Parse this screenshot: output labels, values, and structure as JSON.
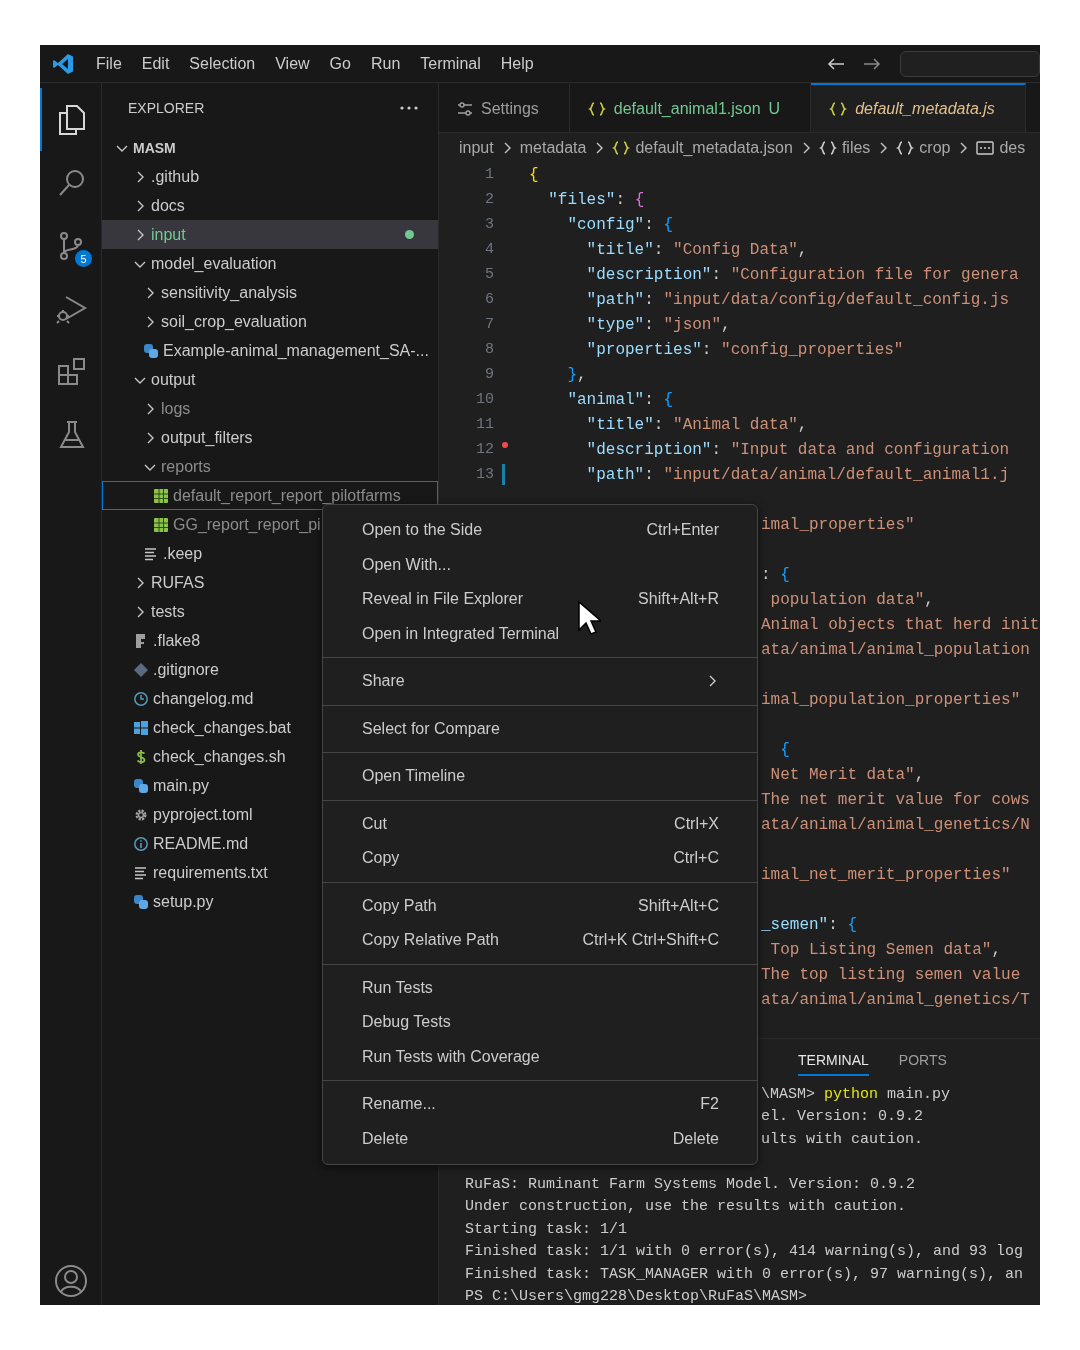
{
  "title_bar": {
    "menu": [
      "File",
      "Edit",
      "Selection",
      "View",
      "Go",
      "Run",
      "Terminal",
      "Help"
    ]
  },
  "activity_bar": {
    "items": [
      {
        "kind": "explorer",
        "selected": true
      },
      {
        "kind": "search",
        "selected": false
      },
      {
        "kind": "source_control",
        "selected": false,
        "badge": "5"
      },
      {
        "kind": "run_debug",
        "selected": false
      },
      {
        "kind": "extensions",
        "selected": false
      },
      {
        "kind": "testing",
        "selected": false
      }
    ]
  },
  "sidebar": {
    "title": "EXPLORER",
    "root": {
      "label": "MASM",
      "expanded": true,
      "children": [
        {
          "label": ".github",
          "kind": "folder",
          "expanded": false,
          "selected": false,
          "focused": false,
          "modified": false,
          "ignored": false
        },
        {
          "label": "docs",
          "kind": "folder",
          "expanded": false,
          "selected": false,
          "focused": false,
          "modified": false,
          "ignored": false
        },
        {
          "label": "input",
          "kind": "folder",
          "expanded": false,
          "selected": true,
          "focused": false,
          "modified": true,
          "ignored": false
        },
        {
          "label": "model_evaluation",
          "kind": "folder",
          "expanded": true,
          "selected": false,
          "focused": false,
          "modified": false,
          "ignored": false,
          "children": [
            {
              "label": "sensitivity_analysis",
              "kind": "folder",
              "expanded": false,
              "selected": false,
              "focused": false,
              "modified": false,
              "ignored": false
            },
            {
              "label": "soil_crop_evaluation",
              "kind": "folder",
              "expanded": false,
              "selected": false,
              "focused": false,
              "modified": false,
              "ignored": false
            },
            {
              "label": "Example-animal_management_SA-...",
              "kind": "python",
              "selected": false,
              "focused": false,
              "modified": false,
              "ignored": false
            }
          ]
        },
        {
          "label": "output",
          "kind": "folder",
          "expanded": true,
          "selected": false,
          "focused": false,
          "modified": false,
          "ignored": false,
          "children": [
            {
              "label": "logs",
              "kind": "folder",
              "expanded": false,
              "selected": false,
              "focused": false,
              "modified": false,
              "ignored": true
            },
            {
              "label": "output_filters",
              "kind": "folder",
              "expanded": false,
              "selected": false,
              "focused": false,
              "modified": false,
              "ignored": false
            },
            {
              "label": "reports",
              "kind": "folder",
              "expanded": true,
              "selected": false,
              "focused": false,
              "modified": false,
              "ignored": true,
              "children": [
                {
                  "label": "default_report_report_pilotfarms",
                  "kind": "table",
                  "selected": false,
                  "focused": true,
                  "modified": false,
                  "ignored": true
                },
                {
                  "label": "GG_report_report_pi",
                  "kind": "table",
                  "selected": false,
                  "focused": false,
                  "modified": false,
                  "ignored": true
                }
              ]
            },
            {
              "label": ".keep",
              "kind": "lines",
              "selected": false,
              "focused": false,
              "modified": false,
              "ignored": false
            }
          ]
        },
        {
          "label": "RUFAS",
          "kind": "folder",
          "expanded": false,
          "selected": false,
          "focused": false,
          "modified": false,
          "ignored": false
        },
        {
          "label": "tests",
          "kind": "folder",
          "expanded": false,
          "selected": false,
          "focused": false,
          "modified": false,
          "ignored": false
        },
        {
          "label": ".flake8",
          "kind": "flake",
          "selected": false,
          "focused": false,
          "modified": false,
          "ignored": false
        },
        {
          "label": ".gitignore",
          "kind": "git",
          "selected": false,
          "focused": false,
          "modified": false,
          "ignored": false
        },
        {
          "label": "changelog.md",
          "kind": "clock",
          "selected": false,
          "focused": false,
          "modified": false,
          "ignored": false
        },
        {
          "label": "check_changes.bat",
          "kind": "windows",
          "selected": false,
          "focused": false,
          "modified": false,
          "ignored": false
        },
        {
          "label": "check_changes.sh",
          "kind": "dollar",
          "selected": false,
          "focused": false,
          "modified": false,
          "ignored": false
        },
        {
          "label": "main.py",
          "kind": "python",
          "selected": false,
          "focused": false,
          "modified": false,
          "ignored": false
        },
        {
          "label": "pyproject.toml",
          "kind": "gear",
          "selected": false,
          "focused": false,
          "modified": false,
          "ignored": false
        },
        {
          "label": "README.md",
          "kind": "info",
          "selected": false,
          "focused": false,
          "modified": false,
          "ignored": false
        },
        {
          "label": "requirements.txt",
          "kind": "lines",
          "selected": false,
          "focused": false,
          "modified": false,
          "ignored": false
        },
        {
          "label": "setup.py",
          "kind": "python",
          "selected": false,
          "focused": false,
          "modified": false,
          "ignored": false
        }
      ]
    }
  },
  "editor": {
    "tabs": [
      {
        "label": "Settings",
        "kind": "settings",
        "selected": false,
        "preview": false,
        "untracked": false
      },
      {
        "label": "default_animal1.json",
        "kind": "json",
        "selected": false,
        "preview": false,
        "untracked": true,
        "decoration": "U"
      },
      {
        "label": "default_metadata.js",
        "kind": "json",
        "selected": true,
        "preview": true,
        "untracked": false
      }
    ],
    "breadcrumbs": [
      {
        "label": "input",
        "kind": "folder"
      },
      {
        "label": "metadata",
        "kind": "folder"
      },
      {
        "label": "default_metadata.json",
        "kind": "json"
      },
      {
        "label": "files",
        "kind": "object"
      },
      {
        "label": "crop",
        "kind": "object"
      },
      {
        "label": "des",
        "kind": "field"
      }
    ],
    "lines": [
      {
        "kind": "code",
        "number": "1",
        "tokens": [
          {
            "kind": "brace1",
            "text": "{"
          }
        ]
      },
      {
        "kind": "code",
        "number": "2",
        "tokens": [
          {
            "kind": "key",
            "text": "  \"files\""
          },
          {
            "kind": "punct",
            "text": ": "
          },
          {
            "kind": "brace2",
            "text": "{"
          }
        ]
      },
      {
        "kind": "code",
        "number": "3",
        "tokens": [
          {
            "kind": "key",
            "text": "    \"config\""
          },
          {
            "kind": "punct",
            "text": ": "
          },
          {
            "kind": "brace3",
            "text": "{"
          }
        ]
      },
      {
        "kind": "code",
        "number": "4",
        "tokens": [
          {
            "kind": "key",
            "text": "      \"title\""
          },
          {
            "kind": "punct",
            "text": ": "
          },
          {
            "kind": "string",
            "text": "\"Config Data\""
          },
          {
            "kind": "punct",
            "text": ","
          }
        ]
      },
      {
        "kind": "code",
        "number": "5",
        "tokens": [
          {
            "kind": "key",
            "text": "      \"description\""
          },
          {
            "kind": "punct",
            "text": ": "
          },
          {
            "kind": "string",
            "text": "\"Configuration file for genera"
          }
        ]
      },
      {
        "kind": "code",
        "number": "6",
        "tokens": [
          {
            "kind": "key",
            "text": "      \"path\""
          },
          {
            "kind": "punct",
            "text": ": "
          },
          {
            "kind": "string",
            "text": "\"input/data/config/default_config.js"
          }
        ]
      },
      {
        "kind": "code",
        "number": "7",
        "tokens": [
          {
            "kind": "key",
            "text": "      \"type\""
          },
          {
            "kind": "punct",
            "text": ": "
          },
          {
            "kind": "string",
            "text": "\"json\""
          },
          {
            "kind": "punct",
            "text": ","
          }
        ]
      },
      {
        "kind": "code",
        "number": "8",
        "tokens": [
          {
            "kind": "key",
            "text": "      \"properties\""
          },
          {
            "kind": "punct",
            "text": ": "
          },
          {
            "kind": "string",
            "text": "\"config_properties\""
          }
        ]
      },
      {
        "kind": "code",
        "number": "9",
        "tokens": [
          {
            "kind": "brace3",
            "text": "    }"
          },
          {
            "kind": "punct",
            "text": ","
          }
        ]
      },
      {
        "kind": "code",
        "number": "10",
        "tokens": [
          {
            "kind": "key",
            "text": "    \"animal\""
          },
          {
            "kind": "punct",
            "text": ": "
          },
          {
            "kind": "brace3",
            "text": "{"
          }
        ]
      },
      {
        "kind": "code",
        "number": "11",
        "tokens": [
          {
            "kind": "key",
            "text": "      \"title\""
          },
          {
            "kind": "punct",
            "text": ": "
          },
          {
            "kind": "string",
            "text": "\"Animal data\""
          },
          {
            "kind": "punct",
            "text": ","
          }
        ]
      },
      {
        "kind": "code_deleted",
        "number": "12",
        "tokens": [
          {
            "kind": "key",
            "text": "      \"description\""
          },
          {
            "kind": "punct",
            "text": ": "
          },
          {
            "kind": "string",
            "text": "\"Input data and configuration"
          }
        ]
      },
      {
        "kind": "code_modified",
        "number": "13",
        "tokens": [
          {
            "kind": "key",
            "text": "      \"path\""
          },
          {
            "kind": "punct",
            "text": ": "
          },
          {
            "kind": "string",
            "text": "\"input/data/animal/default_animal1.j"
          }
        ]
      },
      {
        "kind": "hidden"
      },
      {
        "kind": "fragment",
        "tokens": [
          {
            "kind": "string",
            "text": "imal_properties\""
          }
        ]
      },
      {
        "kind": "hidden"
      },
      {
        "kind": "fragment",
        "tokens": [
          {
            "kind": "punct",
            "text": ": "
          },
          {
            "kind": "brace3",
            "text": "{"
          }
        ]
      },
      {
        "kind": "fragment",
        "tokens": [
          {
            "kind": "string",
            "text": " population data\""
          },
          {
            "kind": "punct",
            "text": ","
          }
        ]
      },
      {
        "kind": "fragment",
        "tokens": [
          {
            "kind": "string",
            "text": "Animal objects that herd init"
          }
        ]
      },
      {
        "kind": "fragment",
        "tokens": [
          {
            "kind": "string",
            "text": "ata/animal/animal_population"
          }
        ]
      },
      {
        "kind": "hidden"
      },
      {
        "kind": "fragment",
        "tokens": [
          {
            "kind": "string",
            "text": "imal_population_properties\""
          }
        ]
      },
      {
        "kind": "hidden"
      },
      {
        "kind": "fragment",
        "tokens": [
          {
            "kind": "brace3",
            "text": "  {"
          }
        ]
      },
      {
        "kind": "fragment",
        "tokens": [
          {
            "kind": "string",
            "text": " Net Merit data\""
          },
          {
            "kind": "punct",
            "text": ","
          }
        ]
      },
      {
        "kind": "fragment",
        "tokens": [
          {
            "kind": "string",
            "text": "The net merit value for cows"
          }
        ]
      },
      {
        "kind": "fragment",
        "tokens": [
          {
            "kind": "string",
            "text": "ata/animal/animal_genetics/N"
          }
        ]
      },
      {
        "kind": "hidden"
      },
      {
        "kind": "fragment",
        "tokens": [
          {
            "kind": "string",
            "text": "imal_net_merit_properties\""
          }
        ]
      },
      {
        "kind": "hidden"
      },
      {
        "kind": "fragment",
        "tokens": [
          {
            "kind": "key",
            "text": "_semen\""
          },
          {
            "kind": "punct",
            "text": ": "
          },
          {
            "kind": "brace3",
            "text": "{"
          }
        ]
      },
      {
        "kind": "fragment",
        "tokens": [
          {
            "kind": "string",
            "text": " Top Listing Semen data\""
          },
          {
            "kind": "punct",
            "text": ","
          }
        ]
      },
      {
        "kind": "fragment",
        "tokens": [
          {
            "kind": "string",
            "text": "The top listing semen value"
          }
        ]
      },
      {
        "kind": "fragment",
        "tokens": [
          {
            "kind": "string",
            "text": "ata/animal/animal_genetics/T"
          }
        ]
      }
    ]
  },
  "panel": {
    "tabs": [
      {
        "label": "TERMINAL",
        "selected": true
      },
      {
        "label": "PORTS",
        "selected": false
      }
    ],
    "lines": [
      {
        "kind": "fragment",
        "tokens": [
          {
            "kind": "plain",
            "text": "\\MASM> "
          },
          {
            "kind": "command",
            "text": "python"
          },
          {
            "kind": "plain",
            "text": " main.py"
          }
        ]
      },
      {
        "kind": "fragment",
        "tokens": [
          {
            "kind": "plain",
            "text": "el. Version: 0.9.2"
          }
        ]
      },
      {
        "kind": "fragment",
        "tokens": [
          {
            "kind": "plain",
            "text": "ults with caution."
          }
        ]
      },
      {
        "kind": "hidden"
      },
      {
        "kind": "full",
        "tokens": [
          {
            "kind": "plain",
            "text": "RuFaS: Ruminant Farm Systems Model. Version: 0.9.2"
          }
        ]
      },
      {
        "kind": "full",
        "tokens": [
          {
            "kind": "plain",
            "text": "Under construction, use the results with caution."
          }
        ]
      },
      {
        "kind": "full",
        "tokens": [
          {
            "kind": "plain",
            "text": "Starting task: 1/1"
          }
        ]
      },
      {
        "kind": "full",
        "tokens": [
          {
            "kind": "plain",
            "text": "Finished task: 1/1 with 0 error(s), 414 warning(s), and 93 log"
          }
        ]
      },
      {
        "kind": "full",
        "tokens": [
          {
            "kind": "plain",
            "text": "Finished task: TASK_MANAGER with 0 error(s), 97 warning(s), an"
          }
        ]
      },
      {
        "kind": "full",
        "tokens": [
          {
            "kind": "plain",
            "text": "PS C:\\Users\\gmg228\\Desktop\\RuFaS\\MASM>"
          }
        ]
      }
    ]
  },
  "context_menu": {
    "groups": [
      {
        "items": [
          {
            "label": "Open to the Side",
            "shortcut": "Ctrl+Enter",
            "submenu": false
          },
          {
            "label": "Open With...",
            "submenu": false
          },
          {
            "label": "Reveal in File Explorer",
            "shortcut": "Shift+Alt+R",
            "submenu": false
          },
          {
            "label": "Open in Integrated Terminal",
            "submenu": false
          }
        ]
      },
      {
        "items": [
          {
            "label": "Share",
            "submenu": true
          }
        ]
      },
      {
        "items": [
          {
            "label": "Select for Compare",
            "submenu": false
          }
        ]
      },
      {
        "items": [
          {
            "label": "Open Timeline",
            "submenu": false
          }
        ]
      },
      {
        "items": [
          {
            "label": "Cut",
            "shortcut": "Ctrl+X",
            "submenu": false
          },
          {
            "label": "Copy",
            "shortcut": "Ctrl+C",
            "submenu": false
          }
        ]
      },
      {
        "items": [
          {
            "label": "Copy Path",
            "shortcut": "Shift+Alt+C",
            "submenu": false
          },
          {
            "label": "Copy Relative Path",
            "shortcut": "Ctrl+K Ctrl+Shift+C",
            "submenu": false
          }
        ]
      },
      {
        "items": [
          {
            "label": "Run Tests",
            "submenu": false
          },
          {
            "label": "Debug Tests",
            "submenu": false
          },
          {
            "label": "Run Tests with Coverage",
            "submenu": false
          }
        ]
      },
      {
        "items": [
          {
            "label": "Rename...",
            "shortcut": "F2",
            "submenu": false
          },
          {
            "label": "Delete",
            "shortcut": "Delete",
            "submenu": false
          }
        ]
      }
    ]
  }
}
